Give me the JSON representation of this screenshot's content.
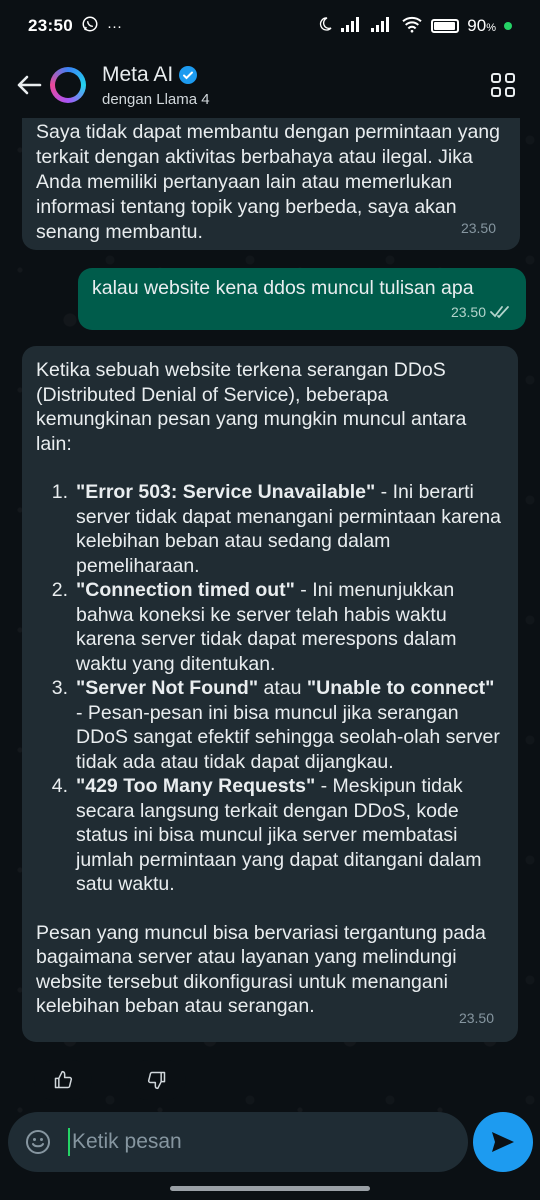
{
  "status_bar": {
    "time": "23:50",
    "whatsapp_icon": "whatsapp-icon",
    "more": "···",
    "battery": "90"
  },
  "header": {
    "title": "Meta AI",
    "subtitle": "dengan Llama 4"
  },
  "messages": {
    "m1": {
      "text": "Saya tidak dapat membantu dengan permintaan yang terkait dengan aktivitas berbahaya atau ilegal. Jika Anda memiliki pertanyaan lain atau memerlukan informasi tentang topik yang berbeda, saya akan senang membantu.",
      "time": "23.50"
    },
    "m2": {
      "text": "kalau website kena ddos muncul tulisan apa",
      "time": "23.50"
    },
    "m3": {
      "intro": "Ketika sebuah website terkena serangan DDoS (Distributed Denial of Service), beberapa kemungkinan pesan yang mungkin muncul antara lain:",
      "items": [
        {
          "num": "1.",
          "bold1": "\"Error 503: Service Unavailable\"",
          "rest": " - Ini berarti server tidak dapat menangani permintaan karena kelebihan beban atau sedang dalam pemeliharaan."
        },
        {
          "num": "2.",
          "bold1": "\"Connection timed out\"",
          "rest": " - Ini menunjukkan bahwa koneksi ke server telah habis waktu karena server tidak dapat merespons dalam waktu yang ditentukan."
        },
        {
          "num": "3.",
          "bold1": "\"Server Not Found\"",
          "mid": " atau ",
          "bold2": "\"Unable to connect\"",
          "rest": " - Pesan-pesan ini bisa muncul jika serangan DDoS sangat efektif sehingga seolah-olah server tidak ada atau tidak dapat dijangkau."
        },
        {
          "num": "4.",
          "bold1": "\"429 Too Many Requests\"",
          "rest": " - Meskipun tidak secara langsung terkait dengan DDoS, kode status ini bisa muncul jika server membatasi jumlah permintaan yang dapat ditangani dalam satu waktu."
        }
      ],
      "outro": "Pesan yang muncul bisa bervariasi tergantung pada bagaimana server atau layanan yang melindungi website tersebut dikonfigurasi untuk menangani kelebihan beban atau serangan.",
      "time": "23.50"
    }
  },
  "input": {
    "placeholder": "Ketik pesan"
  },
  "colors": {
    "background": "#0b1014",
    "incoming_bubble": "#202c33",
    "outgoing_bubble": "#005c4b",
    "accent_blue": "#1d9bf0",
    "caret_green": "#25d366"
  }
}
